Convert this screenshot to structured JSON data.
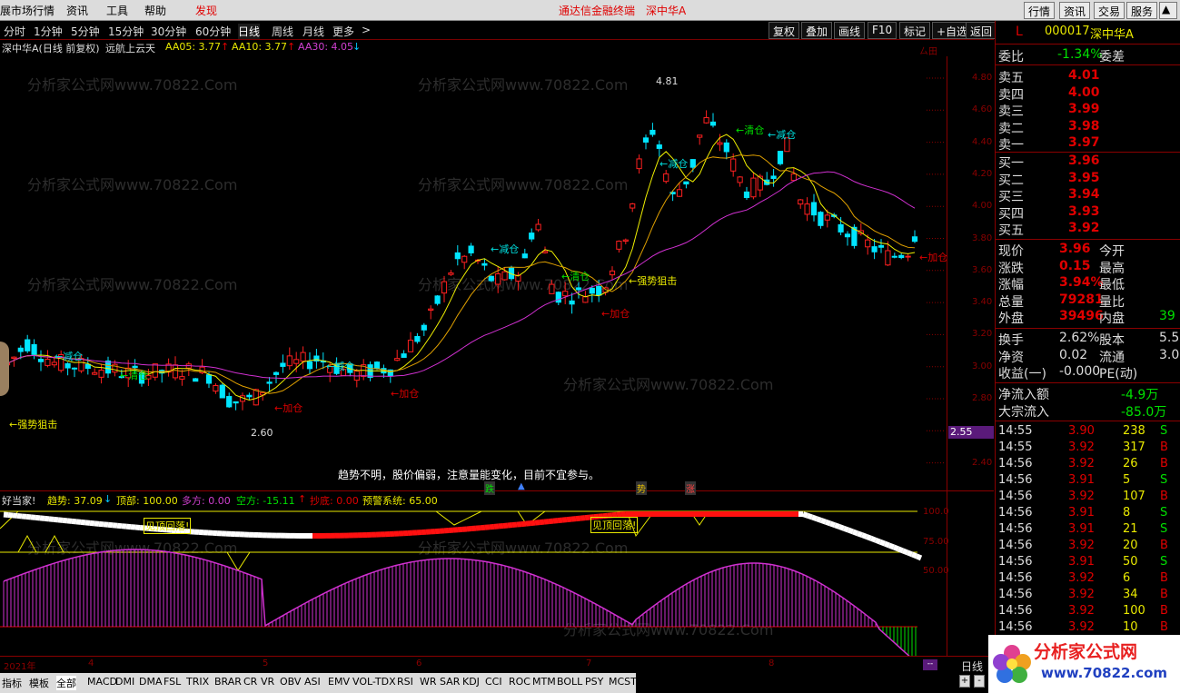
{
  "menu": {
    "items": [
      "展市场行情",
      "资讯",
      "工具",
      "帮助",
      "发现"
    ],
    "title": "通达信金融终端",
    "stock_tag": "深中华A",
    "right_buttons": [
      "行情",
      "资讯",
      "交易",
      "服务"
    ]
  },
  "toolbar": {
    "periods": [
      "分时",
      "1分钟",
      "5分钟",
      "15分钟",
      "30分钟",
      "60分钟",
      "日线",
      "周线",
      "月线",
      "更多"
    ],
    "active": "日线",
    "chevron": ">",
    "actions": [
      "复权",
      "叠加",
      "画线",
      "F10",
      "标记",
      "+自选",
      "返回"
    ]
  },
  "info": {
    "name": "深中华A(日线 前复权)",
    "formula": "远航上云天",
    "ma1": "AA05: 3.77",
    "ma1_arrow": "↑",
    "ma2": "AA10: 3.77",
    "ma2_arrow": "↑",
    "ma3": "AA30: 4.05",
    "ma3_arrow": "↓"
  },
  "main_chart": {
    "y_labels": [
      "4.80",
      "4.60",
      "4.40",
      "4.20",
      "4.00",
      "3.80",
      "3.60",
      "3.40",
      "3.20",
      "3.00",
      "2.80",
      "2.60",
      "2.40"
    ],
    "high_label": "4.81",
    "low_label": "2.60",
    "corner_label": "ㄙ田",
    "cursor_price": "2.55"
  },
  "signals": {
    "qingcang": "←清仓",
    "jiancang": "←减仓",
    "jiacang": "←加仓",
    "qiangshi": "←强势狙击"
  },
  "watermark": "分析家公式网www.70822.Com",
  "message": "趋势不明，股价偏弱，注意量能变化，目前不宜参与。",
  "flags": {
    "die": "跌",
    "up": "▲",
    "shi": "势",
    "zhang": "涨"
  },
  "indicator": {
    "name": "好当家!",
    "trend": "趋势: 37.09",
    "trend_arrow": "↓",
    "top": "顶部: 100.00",
    "bull": "多方: 0.00",
    "bear": "空方: -15.11",
    "bear_arrow": "↑",
    "bottom": "抄底: 0.00",
    "warn": "预警系统: 65.00",
    "y_labels": [
      "100.0",
      "75.00",
      "50.00"
    ],
    "note": "见顶回落!"
  },
  "dates": [
    "2021年",
    "4",
    "5",
    "6",
    "7",
    "8"
  ],
  "quote": {
    "flag": "L",
    "code": "000017",
    "name": "深中华A",
    "weibi_label": "委比",
    "weibi_value": "-1.34%",
    "weicha_label": "委差",
    "sells": [
      {
        "label": "卖五",
        "price": "4.01"
      },
      {
        "label": "卖四",
        "price": "4.00"
      },
      {
        "label": "卖三",
        "price": "3.99"
      },
      {
        "label": "卖二",
        "price": "3.98"
      },
      {
        "label": "卖一",
        "price": "3.97"
      }
    ],
    "buys": [
      {
        "label": "买一",
        "price": "3.96"
      },
      {
        "label": "买二",
        "price": "3.95"
      },
      {
        "label": "买三",
        "price": "3.94"
      },
      {
        "label": "买四",
        "price": "3.93"
      },
      {
        "label": "买五",
        "price": "3.92"
      }
    ],
    "stats": [
      {
        "l": "现价",
        "v": "3.96",
        "r": "今开",
        "rv": ""
      },
      {
        "l": "涨跌",
        "v": "0.15",
        "r": "最高",
        "rv": ""
      },
      {
        "l": "涨幅",
        "v": "3.94%",
        "r": "最低",
        "rv": ""
      },
      {
        "l": "总量",
        "v": "79281",
        "r": "量比",
        "rv": ""
      },
      {
        "l": "外盘",
        "v": "39496",
        "r": "内盘",
        "rv": "39"
      }
    ],
    "stats2": [
      {
        "l": "换手",
        "v": "2.62%",
        "r": "股本",
        "rv": "5.5"
      },
      {
        "l": "净资",
        "v": "0.02",
        "r": "流通",
        "rv": "3.0"
      },
      {
        "l": "收益(一)",
        "v": "-0.000",
        "r": "PE(动)",
        "rv": ""
      }
    ],
    "flows": [
      {
        "l": "净流入额",
        "v": "-4.9万"
      },
      {
        "l": "大宗流入",
        "v": "-85.0万"
      }
    ]
  },
  "ticks": [
    {
      "t": "14:55",
      "p": "3.90",
      "v": "238",
      "s": "S"
    },
    {
      "t": "14:55",
      "p": "3.92",
      "v": "317",
      "s": "B"
    },
    {
      "t": "14:56",
      "p": "3.92",
      "v": "26",
      "s": "B"
    },
    {
      "t": "14:56",
      "p": "3.91",
      "v": "5",
      "s": "S"
    },
    {
      "t": "14:56",
      "p": "3.92",
      "v": "107",
      "s": "B"
    },
    {
      "t": "14:56",
      "p": "3.91",
      "v": "8",
      "s": "S"
    },
    {
      "t": "14:56",
      "p": "3.91",
      "v": "21",
      "s": "S"
    },
    {
      "t": "14:56",
      "p": "3.92",
      "v": "20",
      "s": "B"
    },
    {
      "t": "14:56",
      "p": "3.91",
      "v": "50",
      "s": "S"
    },
    {
      "t": "14:56",
      "p": "3.92",
      "v": "6",
      "s": "B"
    },
    {
      "t": "14:56",
      "p": "3.92",
      "v": "34",
      "s": "B"
    },
    {
      "t": "14:56",
      "p": "3.92",
      "v": "100",
      "s": "B"
    },
    {
      "t": "14:56",
      "p": "3.92",
      "v": "10",
      "s": "B"
    }
  ],
  "bottom": {
    "tabs": [
      "指标",
      "模板",
      "全部",
      "MACD",
      "DMI",
      "DMA",
      "FSL",
      "TRIX",
      "BRAR",
      "CR",
      "VR",
      "OBV",
      "ASI",
      "EMV",
      "VOL-TDX",
      "RSI",
      "WR",
      "SAR",
      "KDJ",
      "CCI",
      "ROC",
      "MTM",
      "BOLL",
      "PSY",
      "MCST"
    ],
    "period": "日线",
    "ctrl": [
      "+",
      "-"
    ]
  },
  "logo": {
    "title": "分析家公式网",
    "url": "www.70822.com"
  }
}
